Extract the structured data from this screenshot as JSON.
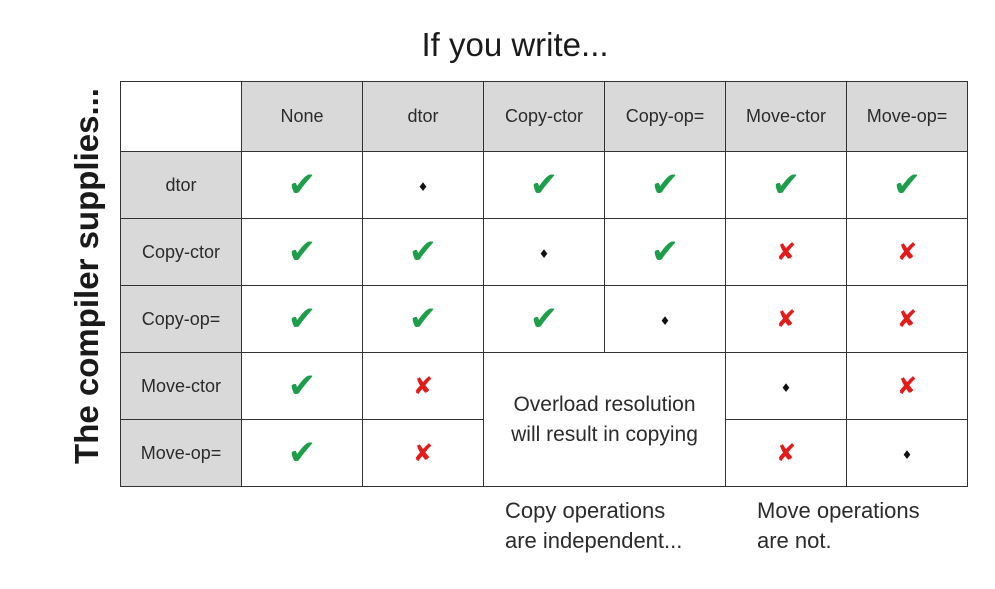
{
  "top_title": "If you write...",
  "side_title": "The compiler supplies...",
  "columns": [
    "None",
    "dtor",
    "Copy-ctor",
    "Copy-op=",
    "Move-ctor",
    "Move-op="
  ],
  "rows": [
    {
      "label": "dtor",
      "cells": [
        "check",
        "diamond",
        "check",
        "check",
        "check",
        "check"
      ]
    },
    {
      "label": "Copy-ctor",
      "cells": [
        "check",
        "check",
        "diamond",
        "check",
        "cross",
        "cross"
      ]
    },
    {
      "label": "Copy-op=",
      "cells": [
        "check",
        "check",
        "check",
        "diamond",
        "cross",
        "cross"
      ]
    },
    {
      "label": "Move-ctor",
      "cells": [
        "check",
        "cross",
        "merged",
        "merged",
        "diamond",
        "cross"
      ]
    },
    {
      "label": "Move-op=",
      "cells": [
        "check",
        "cross",
        "merged",
        "merged",
        "cross",
        "diamond"
      ]
    }
  ],
  "symbols": {
    "check": "✔",
    "cross": "✘",
    "diamond": "♦"
  },
  "merged_cell_text": "Overload resolution\nwill result in copying",
  "notes": {
    "copy": "Copy operations\nare independent...",
    "move": "Move operations\nare not."
  },
  "colors": {
    "header_bg": "#d9d9d9",
    "check": "#1e9e4a",
    "cross": "#e31b1b",
    "border": "#333333"
  }
}
